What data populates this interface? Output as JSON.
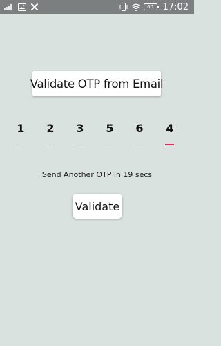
{
  "status_bar": {
    "battery": "60",
    "time": "17:02",
    "left_icons": [
      "signal-bars-icon",
      "image-icon",
      "app-badge-icon"
    ],
    "right_icons": [
      "vibrate-icon",
      "wifi-icon",
      "battery-icon"
    ]
  },
  "title": "Validate OTP from Email",
  "otp": {
    "digits": [
      "1",
      "2",
      "3",
      "5",
      "6",
      "4"
    ],
    "active_index": 5,
    "underline_color": "#f08fa8",
    "active_underline_color": "#e8275a"
  },
  "resend_text": "Send Another OTP in 19 secs",
  "validate_label": "Validate",
  "colors": {
    "background": "#dae2e0",
    "status_bar": "#7b7f80"
  }
}
